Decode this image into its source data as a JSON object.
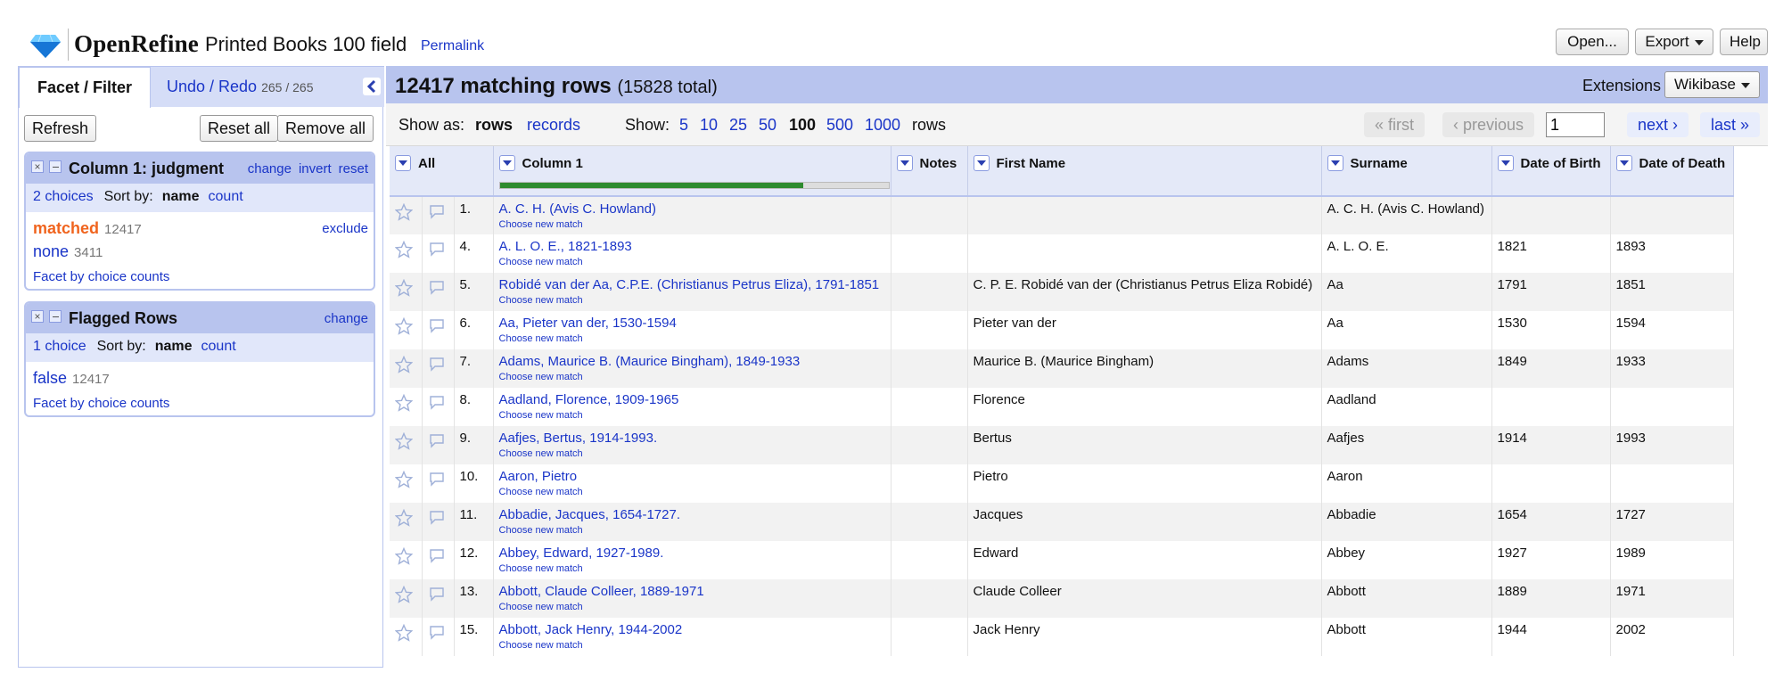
{
  "header": {
    "logo_text": "OpenRefine",
    "project_name": "Printed Books 100 field",
    "permalink": "Permalink",
    "buttons": {
      "open": "Open...",
      "export": "Export",
      "help": "Help"
    }
  },
  "left_panel": {
    "tabs": {
      "facet": "Facet / Filter",
      "undo": "Undo / Redo",
      "undo_count": "265 / 265"
    },
    "refresh": "Refresh",
    "reset_all": "Reset all",
    "remove_all": "Remove all",
    "facets": [
      {
        "name": "Column 1: judgment",
        "actions": [
          "change",
          "invert",
          "reset"
        ],
        "choices_label": "2 choices",
        "sort_label": "Sort by:",
        "sort_name": "name",
        "sort_count": "count",
        "exclude": "exclude",
        "choices": [
          {
            "label": "matched",
            "count": "12417"
          },
          {
            "label": "none",
            "count": "3411"
          }
        ],
        "footer": "Facet by choice counts"
      },
      {
        "name": "Flagged Rows",
        "actions": [
          "change"
        ],
        "choices_label": "1 choice",
        "sort_label": "Sort by:",
        "sort_name": "name",
        "sort_count": "count",
        "choices": [
          {
            "label": "false",
            "count": "12417"
          }
        ],
        "footer": "Facet by choice counts"
      }
    ]
  },
  "right_panel": {
    "summary": {
      "matching": "12417 matching rows",
      "total": "(15828 total)"
    },
    "extensions_label": "Extensions",
    "wikibase": "Wikibase",
    "view": {
      "show_as": "Show as:",
      "rows": "rows",
      "records": "records",
      "show": "Show:",
      "page_sizes": [
        "5",
        "10",
        "25",
        "50",
        "100",
        "500",
        "1000"
      ],
      "selected_size": "100",
      "rows_suffix": "rows",
      "first": "« first",
      "previous": "‹ previous",
      "page": "1",
      "next": "next ›",
      "last": "last »"
    },
    "recon_progress": 0.78,
    "columns": [
      "All",
      "Column 1",
      "Notes",
      "First Name",
      "Surname",
      "Date of Birth",
      "Date of Death"
    ],
    "choose_new_match": "Choose new match",
    "rows": [
      {
        "n": "1.",
        "col1": "A. C. H. (Avis C. Howland)",
        "notes": "",
        "first": "",
        "surname": "A. C. H. (Avis C. Howland)",
        "dob": "",
        "dod": ""
      },
      {
        "n": "4.",
        "col1": "A. L. O. E., 1821-1893",
        "notes": "",
        "first": "",
        "surname": "A. L. O. E.",
        "dob": "1821",
        "dod": "1893"
      },
      {
        "n": "5.",
        "col1": "Robidé van der Aa, C.P.E. (Christianus Petrus Eliza), 1791-1851",
        "notes": "",
        "first": "C. P. E. Robidé van der (Christianus Petrus Eliza Robidé)",
        "surname": "Aa",
        "dob": "1791",
        "dod": "1851"
      },
      {
        "n": "6.",
        "col1": "Aa, Pieter van der, 1530-1594",
        "notes": "",
        "first": "Pieter van der",
        "surname": "Aa",
        "dob": "1530",
        "dod": "1594"
      },
      {
        "n": "7.",
        "col1": "Adams, Maurice B. (Maurice Bingham), 1849-1933",
        "notes": "",
        "first": "Maurice B. (Maurice Bingham)",
        "surname": "Adams",
        "dob": "1849",
        "dod": "1933"
      },
      {
        "n": "8.",
        "col1": "Aadland, Florence, 1909-1965",
        "notes": "",
        "first": "Florence",
        "surname": "Aadland",
        "dob": "",
        "dod": ""
      },
      {
        "n": "9.",
        "col1": "Aafjes, Bertus, 1914-1993.",
        "notes": "",
        "first": "Bertus",
        "surname": "Aafjes",
        "dob": "1914",
        "dod": "1993"
      },
      {
        "n": "10.",
        "col1": "Aaron, Pietro",
        "notes": "",
        "first": "Pietro",
        "surname": "Aaron",
        "dob": "",
        "dod": ""
      },
      {
        "n": "11.",
        "col1": "Abbadie, Jacques, 1654-1727.",
        "notes": "",
        "first": "Jacques",
        "surname": "Abbadie",
        "dob": "1654",
        "dod": "1727"
      },
      {
        "n": "12.",
        "col1": "Abbey, Edward, 1927-1989.",
        "notes": "",
        "first": "Edward",
        "surname": "Abbey",
        "dob": "1927",
        "dod": "1989"
      },
      {
        "n": "13.",
        "col1": "Abbott, Claude Colleer, 1889-1971",
        "notes": "",
        "first": "Claude Colleer",
        "surname": "Abbott",
        "dob": "1889",
        "dod": "1971"
      },
      {
        "n": "15.",
        "col1": "Abbott, Jack Henry, 1944-2002",
        "notes": "",
        "first": "Jack Henry",
        "surname": "Abbott",
        "dob": "1944",
        "dod": "2002"
      }
    ]
  },
  "colors": {
    "accent_blue": "#1a35c8",
    "panel_blue": "#b8c4ee",
    "matched_orange": "#f0641e",
    "recon_green": "#2e8b2e"
  }
}
